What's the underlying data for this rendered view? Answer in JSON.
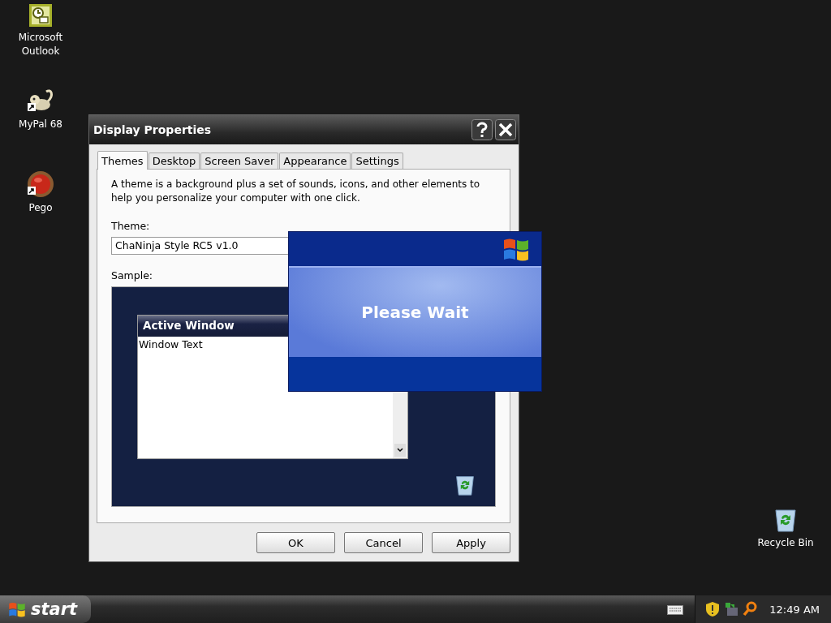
{
  "desktop_icons": [
    {
      "kind": "outlook",
      "label": "Microsoft Outlook",
      "shortcut": false
    },
    {
      "kind": "mypal",
      "label": "MyPal 68",
      "shortcut": true
    },
    {
      "kind": "pego",
      "label": "Pego",
      "shortcut": true
    },
    {
      "kind": "recycle",
      "label": "Recycle Bin",
      "shortcut": false
    }
  ],
  "dialog": {
    "title": "Display Properties",
    "tabs": [
      {
        "label": "Themes",
        "selected": true
      },
      {
        "label": "Desktop",
        "selected": false
      },
      {
        "label": "Screen Saver",
        "selected": false
      },
      {
        "label": "Appearance",
        "selected": false
      },
      {
        "label": "Settings",
        "selected": false
      }
    ],
    "description": "A theme is a background plus a set of sounds, icons, and other elements to help you personalize your computer with one click.",
    "theme_label": "Theme:",
    "theme_value": "ChaNinja Style RC5 v1.0",
    "sample_label": "Sample:",
    "sample": {
      "window_title": "Active Window",
      "window_text": "Window Text"
    },
    "buttons": [
      "OK",
      "Cancel",
      "Apply"
    ]
  },
  "splash": {
    "message": "Please Wait"
  },
  "taskbar": {
    "start_label": "start",
    "clock": "12:49 AM"
  }
}
